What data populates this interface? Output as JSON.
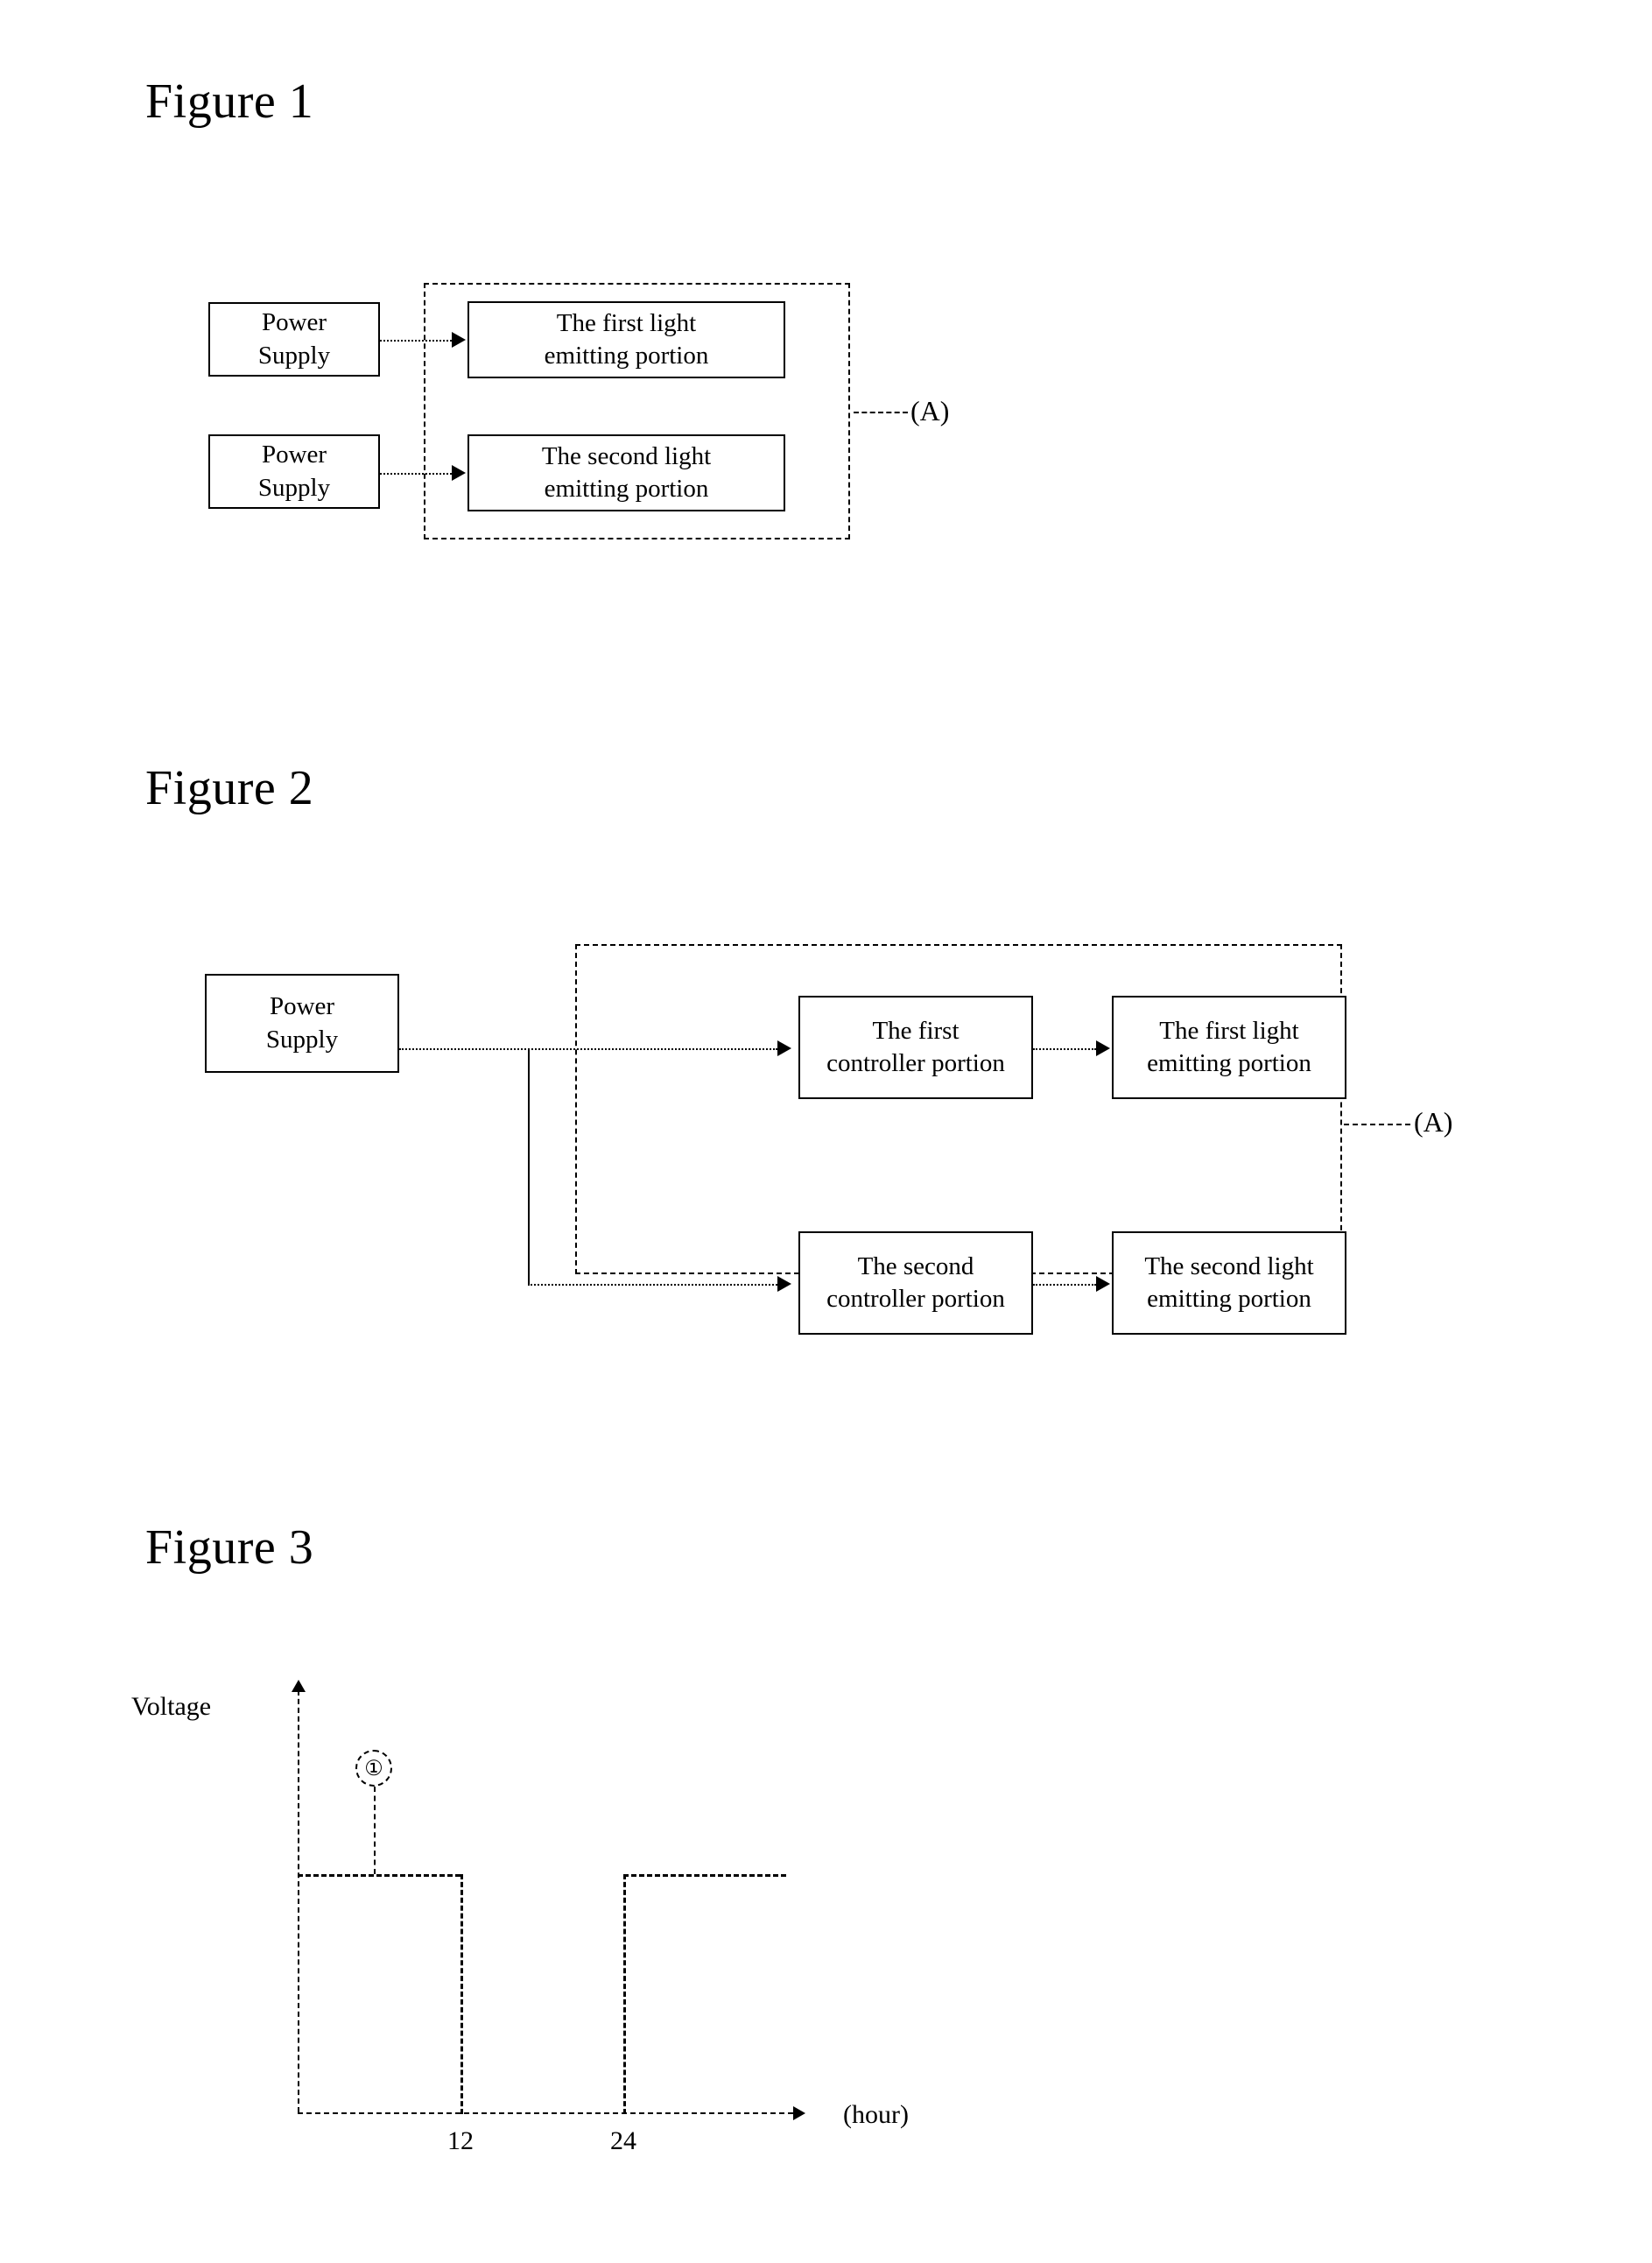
{
  "figures": [
    {
      "title": "Figure 1",
      "group_label": "(A)",
      "boxes": {
        "power_supply_1": {
          "line1": "Power",
          "line2": "Supply"
        },
        "power_supply_2": {
          "line1": "Power",
          "line2": "Supply"
        },
        "first_light": {
          "line1": "The first light",
          "line2": "emitting portion"
        },
        "second_light": {
          "line1": "The second light",
          "line2": "emitting portion"
        }
      }
    },
    {
      "title": "Figure 2",
      "group_label": "(A)",
      "boxes": {
        "power_supply": {
          "line1": "Power",
          "line2": "Supply"
        },
        "first_controller": {
          "line1": "The first",
          "line2": "controller portion"
        },
        "second_controller": {
          "line1": "The second",
          "line2": "controller portion"
        },
        "first_light": {
          "line1": "The first light",
          "line2": "emitting portion"
        },
        "second_light": {
          "line1": "The second light",
          "line2": "emitting portion"
        }
      }
    },
    {
      "title": "Figure 3"
    }
  ],
  "chart_data": {
    "type": "line",
    "title": "Figure 3",
    "xlabel": "(hour)",
    "ylabel": "Voltage",
    "x_tick_labels": [
      "12",
      "24"
    ],
    "x_tick_values": [
      12,
      24
    ],
    "xlim": [
      0,
      40
    ],
    "ylim": [
      0,
      1.45
    ],
    "grid": false,
    "legend": null,
    "annotation_label": "①",
    "series": [
      {
        "name": "Voltage waveform",
        "points": [
          {
            "x": 0,
            "y": 1
          },
          {
            "x": 12,
            "y": 1
          },
          {
            "x": 12,
            "y": 0
          },
          {
            "x": 24,
            "y": 0
          },
          {
            "x": 24,
            "y": 1
          },
          {
            "x": 36,
            "y": 1
          }
        ]
      }
    ]
  }
}
